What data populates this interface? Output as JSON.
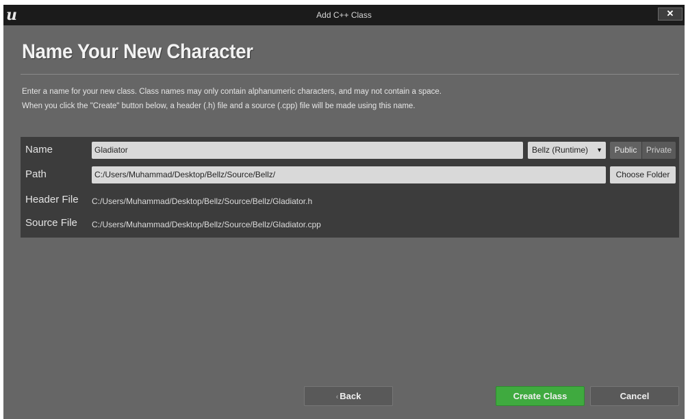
{
  "window": {
    "title": "Add C++ Class",
    "logo": "u",
    "close_label": "✕"
  },
  "heading": "Name Your New Character",
  "description": {
    "line1": "Enter a name for your new class. Class names may only contain alphanumeric characters, and may not contain a space.",
    "line2": "When you click the \"Create\" button below, a header (.h) file and a source (.cpp) file will be made using this name."
  },
  "form": {
    "name_label": "Name",
    "name_value": "Gladiator",
    "module_value": "Bellz (Runtime)",
    "public_label": "Public",
    "private_label": "Private",
    "path_label": "Path",
    "path_value": "C:/Users/Muhammad/Desktop/Bellz/Source/Bellz/",
    "choose_folder_label": "Choose Folder",
    "header_label": "Header File",
    "header_value": "C:/Users/Muhammad/Desktop/Bellz/Source/Bellz/Gladiator.h",
    "source_label": "Source File",
    "source_value": "C:/Users/Muhammad/Desktop/Bellz/Source/Bellz/Gladiator.cpp"
  },
  "footer": {
    "back_label": "Back",
    "create_label": "Create Class",
    "cancel_label": "Cancel"
  },
  "colors": {
    "background": "#666666",
    "titlebar": "#1b1b1b",
    "panel": "#3c3c3c",
    "field": "#d9d9d9",
    "create_accent": "#3faa3f"
  },
  "icons": {
    "logo": "unreal-engine-logo",
    "close": "close-icon",
    "dropdown": "caret-down-icon",
    "back": "chevron-left-icon"
  }
}
